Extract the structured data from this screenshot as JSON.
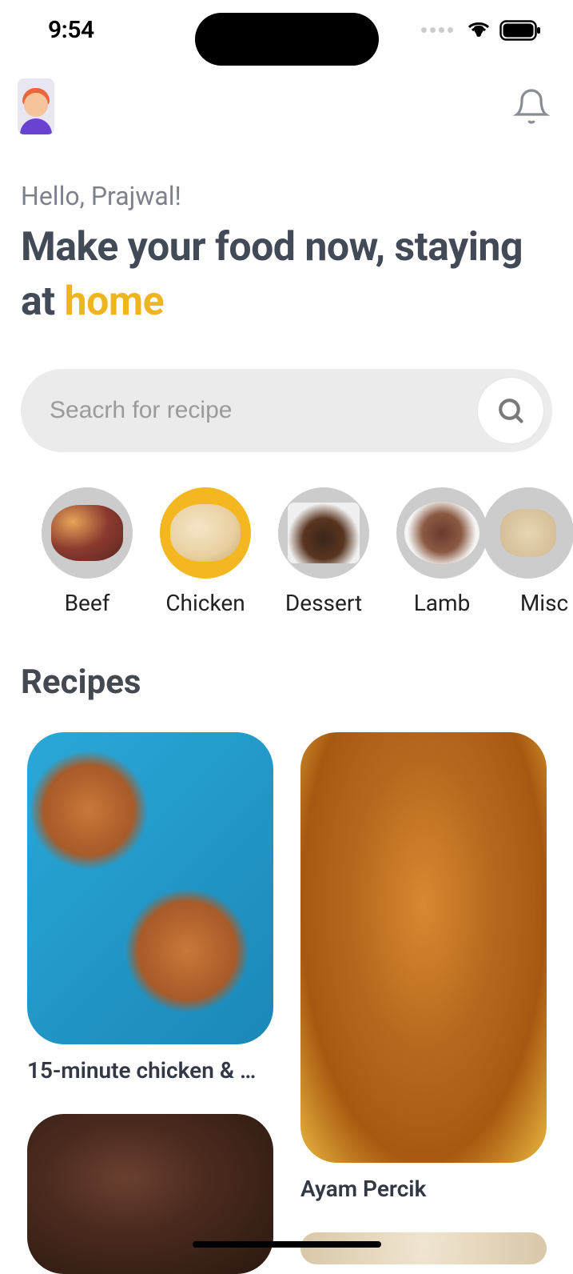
{
  "status": {
    "time": "9:54"
  },
  "greeting": "Hello, Prajwal!",
  "headline_part1": "Make your food now, staying at ",
  "headline_accent": "home",
  "search": {
    "placeholder": "Seacrh for recipe"
  },
  "categories": [
    {
      "label": "Beef",
      "active": false
    },
    {
      "label": "Chicken",
      "active": true
    },
    {
      "label": "Dessert",
      "active": false
    },
    {
      "label": "Lamb",
      "active": false
    },
    {
      "label": "Misc",
      "active": false
    }
  ],
  "section_title": "Recipes",
  "recipes": {
    "col1": [
      {
        "title": "15-minute chicken & …"
      }
    ],
    "col2": [
      {
        "title": "Ayam Percik"
      }
    ]
  }
}
